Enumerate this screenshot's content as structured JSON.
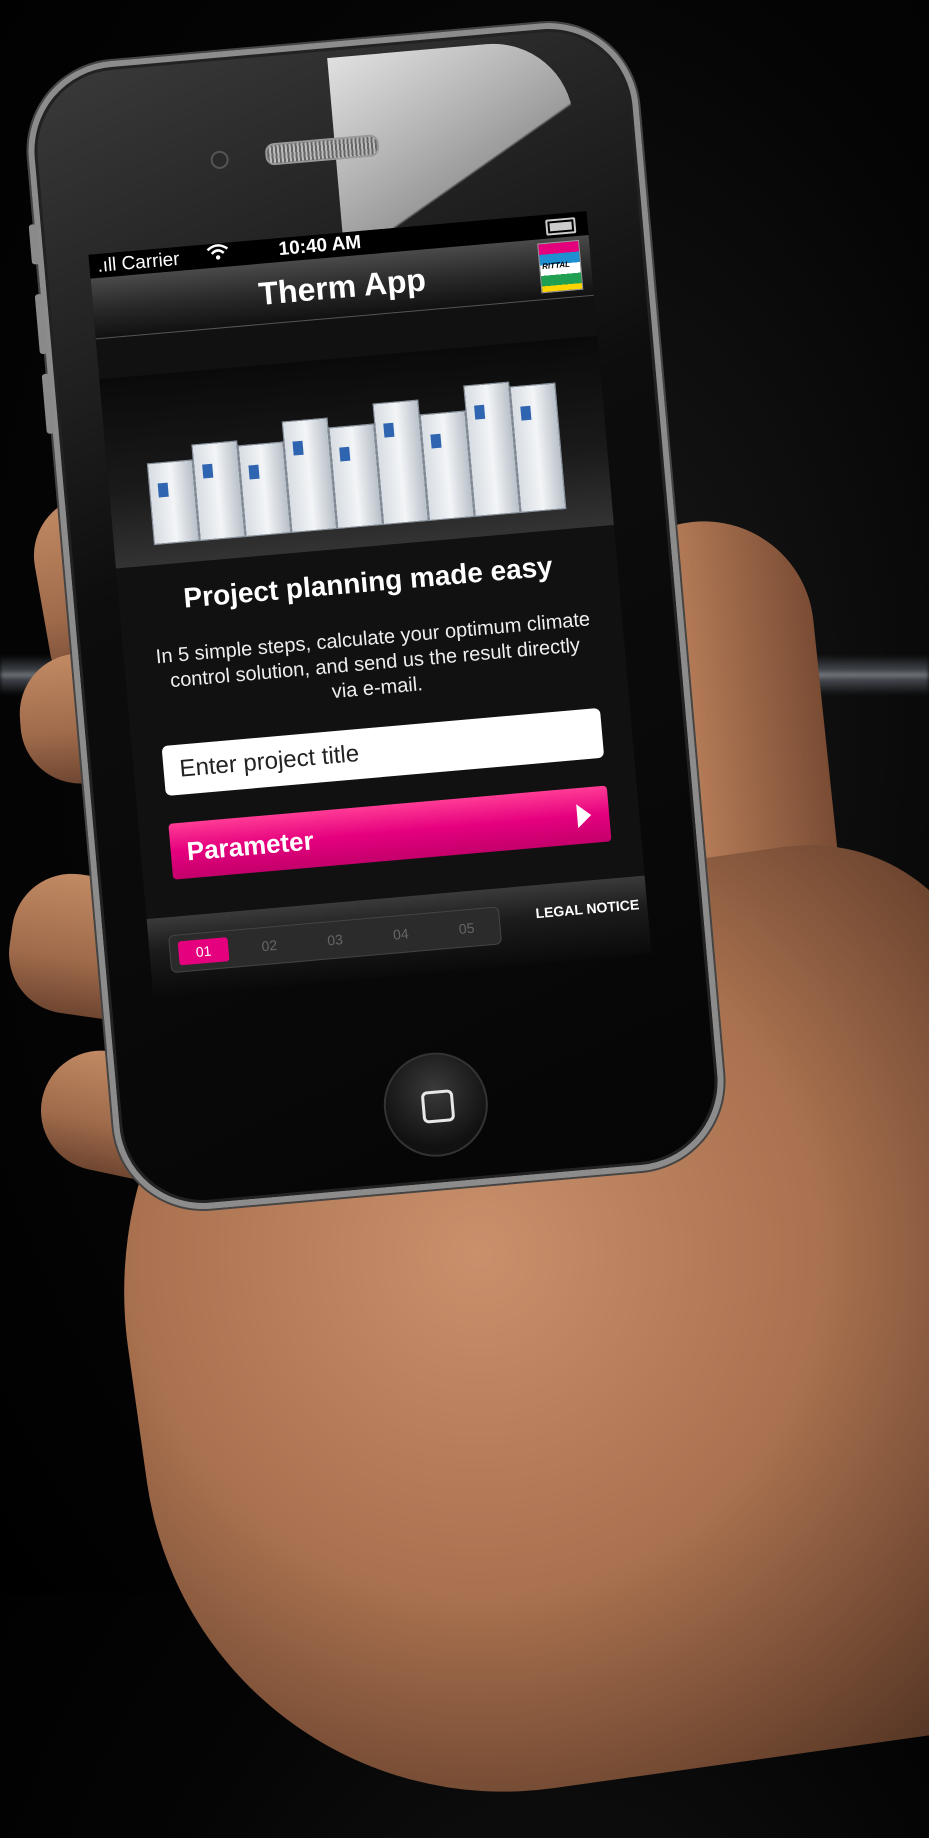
{
  "status_bar": {
    "carrier": ".ıll Carrier",
    "time": "10:40 AM"
  },
  "nav": {
    "title": "Therm App",
    "logo_text": "RITTAL"
  },
  "content": {
    "headline": "Project planning made easy",
    "description": "In 5 simple steps, calculate your optimum climate control solution, and send us the result directly via e-mail.",
    "project_input_placeholder": "Enter project title",
    "parameter_button": "Parameter"
  },
  "footer": {
    "steps": [
      "01",
      "02",
      "03",
      "04",
      "05"
    ],
    "active_step": "01",
    "legal_notice": "LEGAL NOTICE"
  },
  "colors": {
    "accent": "#e5007e",
    "background": "#000000"
  }
}
